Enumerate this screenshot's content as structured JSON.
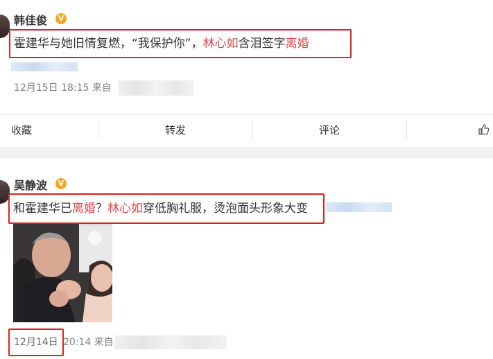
{
  "post1": {
    "username": "韩佳俊",
    "verified_badge": "V",
    "text_before": "霍建华与她旧情复燃，“我保护你”，",
    "name_highlight": "林心如",
    "text_middle": "含泪签字",
    "word_highlight": "离婚",
    "timestamp": "12月15日 18:15 来自"
  },
  "actions": {
    "favorite": "收藏",
    "repost": "转发",
    "comment": "评论",
    "like_icon": "thumbs-up-icon"
  },
  "post2": {
    "username": "吴静波",
    "verified_badge": "V",
    "text_before": "和霍建华已",
    "word_highlight": "离婚",
    "text_q": "？",
    "name_highlight": "林心如",
    "text_after": "穿低胸礼服，烫泡面头形象大变",
    "date": "12月14日",
    "time_source": "20:14 来自"
  },
  "colors": {
    "highlight": "#e0484e",
    "box": "#d9241f",
    "badge": "#f6a623"
  }
}
